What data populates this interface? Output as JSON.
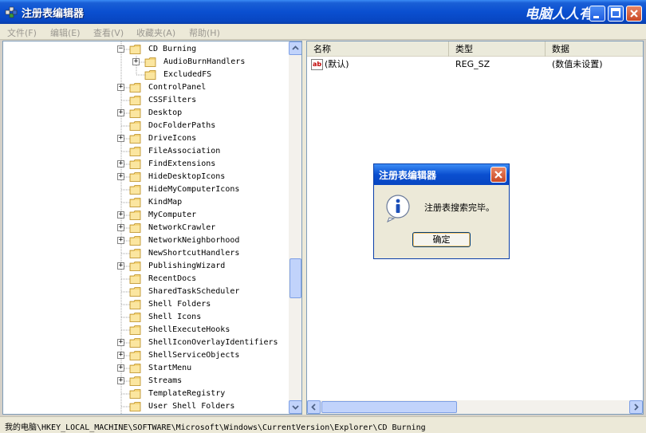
{
  "window": {
    "title": "注册表编辑器",
    "watermark": "电脑人人有"
  },
  "menu": [
    {
      "label": "文件(F)"
    },
    {
      "label": "编辑(E)"
    },
    {
      "label": "查看(V)"
    },
    {
      "label": "收藏夹(A)"
    },
    {
      "label": "帮助(H)"
    }
  ],
  "tree": {
    "items": [
      {
        "label": "CD Burning",
        "expander": "−",
        "selected": false
      },
      {
        "label": "AudioBurnHandlers",
        "expander": "+"
      },
      {
        "label": "ExcludedFS",
        "expander": ""
      },
      {
        "label": "ControlPanel",
        "expander": "+"
      },
      {
        "label": "CSSFilters",
        "expander": ""
      },
      {
        "label": "Desktop",
        "expander": "+"
      },
      {
        "label": "DocFolderPaths",
        "expander": ""
      },
      {
        "label": "DriveIcons",
        "expander": "+"
      },
      {
        "label": "FileAssociation",
        "expander": ""
      },
      {
        "label": "FindExtensions",
        "expander": "+"
      },
      {
        "label": "HideDesktopIcons",
        "expander": "+"
      },
      {
        "label": "HideMyComputerIcons",
        "expander": ""
      },
      {
        "label": "KindMap",
        "expander": ""
      },
      {
        "label": "MyComputer",
        "expander": "+"
      },
      {
        "label": "NetworkCrawler",
        "expander": "+"
      },
      {
        "label": "NetworkNeighborhood",
        "expander": "+"
      },
      {
        "label": "NewShortcutHandlers",
        "expander": ""
      },
      {
        "label": "PublishingWizard",
        "expander": "+"
      },
      {
        "label": "RecentDocs",
        "expander": ""
      },
      {
        "label": "SharedTaskScheduler",
        "expander": ""
      },
      {
        "label": "Shell Folders",
        "expander": ""
      },
      {
        "label": "Shell Icons",
        "expander": ""
      },
      {
        "label": "ShellExecuteHooks",
        "expander": ""
      },
      {
        "label": "ShellIconOverlayIdentifiers",
        "expander": "+"
      },
      {
        "label": "ShellServiceObjects",
        "expander": "+"
      },
      {
        "label": "StartMenu",
        "expander": "+"
      },
      {
        "label": "Streams",
        "expander": "+"
      },
      {
        "label": "TemplateRegistry",
        "expander": ""
      },
      {
        "label": "User Shell Folders",
        "expander": ""
      }
    ]
  },
  "list": {
    "columns": {
      "name": "名称",
      "type": "类型",
      "data": "数据"
    },
    "rows": [
      {
        "icon": "ab",
        "name": "(默认)",
        "type": "REG_SZ",
        "data": "(数值未设置)"
      }
    ]
  },
  "status": {
    "path": "我的电脑\\HKEY_LOCAL_MACHINE\\SOFTWARE\\Microsoft\\Windows\\CurrentVersion\\Explorer\\CD Burning"
  },
  "dialog": {
    "title": "注册表编辑器",
    "message": "注册表搜索完毕。",
    "ok_label": "确定"
  },
  "colors": {
    "titlebar": "#0a4fd0",
    "folder": "#f5d57a",
    "list_bg": "#ffffff"
  }
}
